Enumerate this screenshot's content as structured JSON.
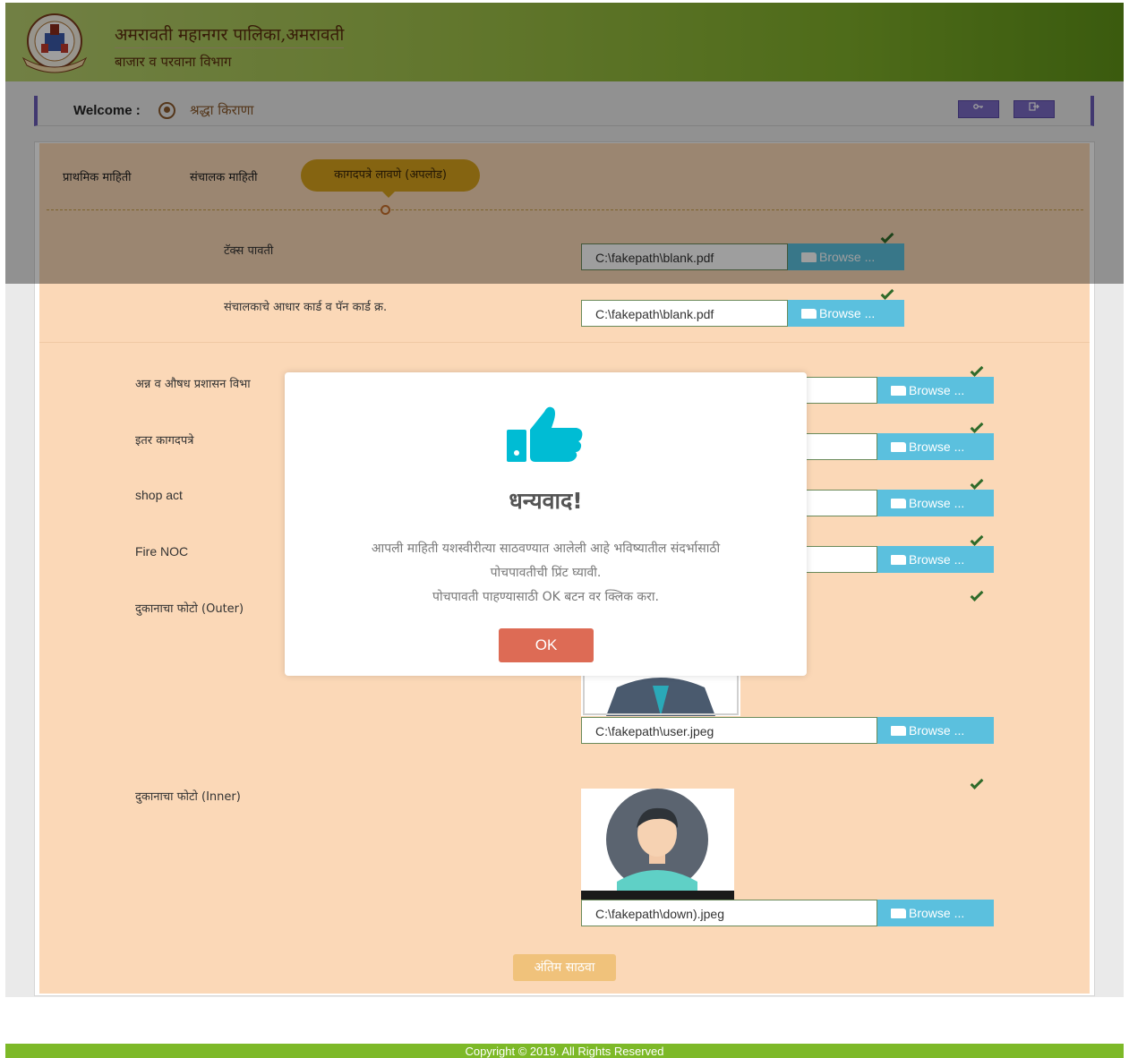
{
  "header": {
    "title": "अमरावती महानगर पालिका,अमरावती",
    "subtitle": "बाजार व परवाना विभाग",
    "logo_icon": "municipal-emblem-icon"
  },
  "welcome": {
    "label": "Welcome :",
    "user_name": "श्रद्धा किराणा",
    "user_icon": "user-circle-icon",
    "key_button_icon": "key-icon",
    "logout_button_icon": "logout-icon"
  },
  "tabs": [
    {
      "label": "प्राथमिक माहिती"
    },
    {
      "label": "संचालक माहिती"
    },
    {
      "label": "कागदपत्रे लावणे (अपलोड)"
    }
  ],
  "documents": [
    {
      "label": "टॅक्स पावती",
      "value": "C:\\fakepath\\blank.pdf",
      "browse": "Browse ..."
    },
    {
      "label": "संचालकाचे आधार कार्ड व पॅन कार्ड क्र.",
      "value": "C:\\fakepath\\blank.pdf",
      "browse": "Browse ..."
    },
    {
      "label": "अन्न व औषध प्रशासन विभा",
      "value": "",
      "browse": "Browse ..."
    },
    {
      "label": "इतर कागदपत्रे",
      "value": "",
      "browse": "Browse ..."
    },
    {
      "label": "shop act",
      "value": "",
      "browse": "Browse ..."
    },
    {
      "label": "Fire NOC",
      "value": "",
      "browse": "Browse ..."
    },
    {
      "label": "दुकानाचा फोटो (Outer)",
      "value": "C:\\fakepath\\user.jpeg",
      "browse": "Browse ..."
    },
    {
      "label": "दुकानाचा फोटो (Inner)",
      "value": "C:\\fakepath\\down).jpeg",
      "browse": "Browse ..."
    }
  ],
  "final_button": "अंतिम साठवा",
  "modal": {
    "icon": "thumbs-up-icon",
    "title": "धन्यवाद!",
    "line1": "आपली माहिती यशस्वीरीत्या साठवण्यात आलेली आहे भविष्यातील संदर्भासाठी",
    "line2": "पोचपावतीची प्रिंट घ्यावी.",
    "line3": "पोचपावती पाहण्यासाठी OK बटन वर क्लिक करा.",
    "ok": "OK"
  },
  "footer": "Copyright © 2019. All Rights Reserved",
  "colors": {
    "accent": "#d7a21c",
    "browse": "#5bc0de",
    "panel": "#fbd8b7",
    "ok": "#dd6b55",
    "thumbs": "#00bcd4",
    "footer": "#7db928"
  }
}
